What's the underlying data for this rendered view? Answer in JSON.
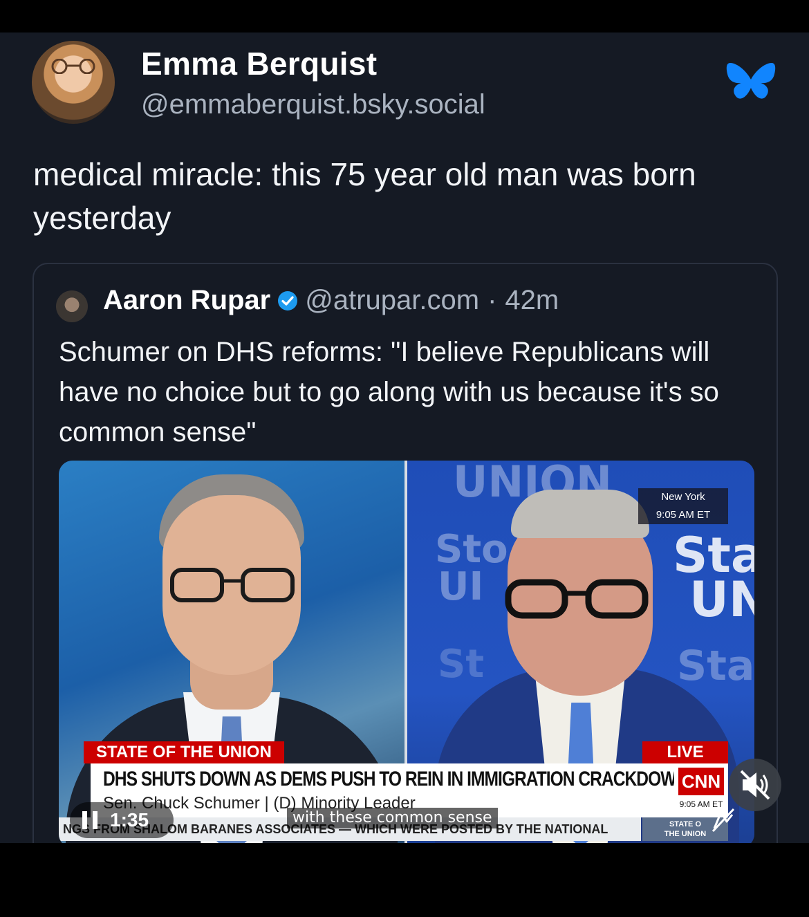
{
  "author": {
    "display_name": "Emma Berquist",
    "handle": "@emmaberquist.bsky.social"
  },
  "post": {
    "text": "medical miracle: this 75 year old man was born yesterday"
  },
  "quote": {
    "display_name": "Aaron Rupar",
    "handle": "@atrupar.com",
    "separator": "·",
    "time": "42m",
    "text": "Schumer on DHS reforms: \"I believe Republicans will have no choice but to go along with us because it's so common sense\""
  },
  "video": {
    "bg_words": {
      "union_top": "UNION",
      "sta_right": "Sta",
      "un_right": "UN",
      "sta_faint": "Sta",
      "st_left": "Sto",
      "un_left": "UI",
      "st_left2": "St"
    },
    "location": "New York",
    "location_time": "9:05 AM ET",
    "show_tag": "STATE OF THE UNION",
    "live_tag": "LIVE",
    "headline": "DHS SHUTS DOWN AS DEMS PUSH TO REIN IN IMMIGRATION CRACKDOWN",
    "subhead": "Sen. Chuck Schumer  |  (D) Minority Leader",
    "network_logo": "CNN",
    "network_time": "9:05 AM ET",
    "ticker": "NGS FROM SHALOM BARANES ASSOCIATES — WHICH WERE POSTED BY THE NATIONAL",
    "show_logo_line1": "STATE O",
    "show_logo_line2": "THE UNION",
    "playback_time": "1:35",
    "caption": "with these common sense"
  },
  "icons": {
    "platform": "butterfly-icon",
    "verified": "verified-check-icon",
    "pause": "pause-icon",
    "mute": "muted-speaker-icon",
    "captions": "captions-off-icon"
  },
  "colors": {
    "post_bg": "#151a24",
    "bluesky_blue": "#1185fe",
    "cnn_red": "#cc0000",
    "verified_blue": "#1d9bf0"
  }
}
